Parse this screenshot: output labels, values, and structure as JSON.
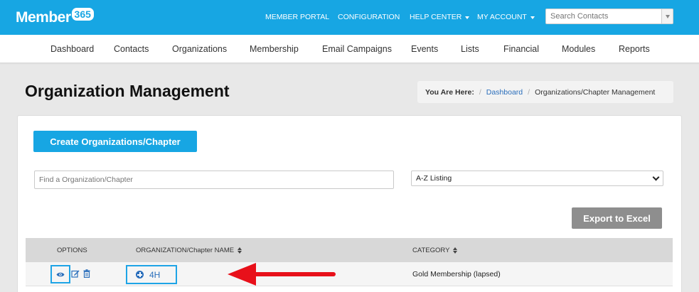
{
  "header": {
    "logo_text": "Member",
    "logo_badge": "365",
    "nav": [
      "MEMBER PORTAL",
      "CONFIGURATION",
      "HELP CENTER",
      "MY ACCOUNT"
    ],
    "search_placeholder": "Search Contacts"
  },
  "subnav": [
    "Dashboard",
    "Contacts",
    "Organizations",
    "Membership",
    "Email Campaigns",
    "Events",
    "Lists",
    "Financial",
    "Modules",
    "Reports"
  ],
  "page": {
    "title": "Organization Management",
    "breadcrumb": {
      "label": "You Are Here:",
      "link": "Dashboard",
      "current": "Organizations/Chapter Management"
    }
  },
  "actions": {
    "create_label": "Create Organizations/Chapter",
    "find_placeholder": "Find a Organization/Chapter",
    "listing_selected": "A-Z Listing",
    "export_label": "Export to Excel"
  },
  "table": {
    "headers": [
      "OPTIONS",
      "ORGANIZATION/Chapter NAME",
      "CATEGORY"
    ],
    "rows": [
      {
        "name": "4H",
        "category": "Gold Membership (lapsed)"
      }
    ]
  },
  "colors": {
    "brand": "#17a6e3",
    "highlight": "#1ea4e6",
    "arrow": "#e8101a",
    "link": "#2a6ebb"
  },
  "icons": [
    "eye-icon",
    "edit-icon",
    "trash-icon",
    "plus-circle-icon",
    "sort-icon",
    "caret-down-icon"
  ]
}
